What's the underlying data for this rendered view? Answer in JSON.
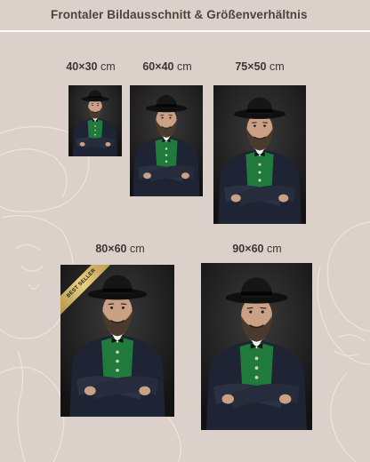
{
  "header": {
    "title": "Frontaler Bildausschnitt & Größenverhältnis"
  },
  "sizes": [
    {
      "dims": "40×30",
      "unit": "cm"
    },
    {
      "dims": "60×40",
      "unit": "cm"
    },
    {
      "dims": "75×50",
      "unit": "cm"
    },
    {
      "dims": "80×60",
      "unit": "cm",
      "badge": "BEST SELLER"
    },
    {
      "dims": "90×60",
      "unit": "cm"
    }
  ],
  "colors": {
    "background": "#dcd1ca",
    "ribbon_gold": "#d8b96a",
    "vest_green": "#1f7a3c",
    "jacket_navy": "#1e2433"
  }
}
